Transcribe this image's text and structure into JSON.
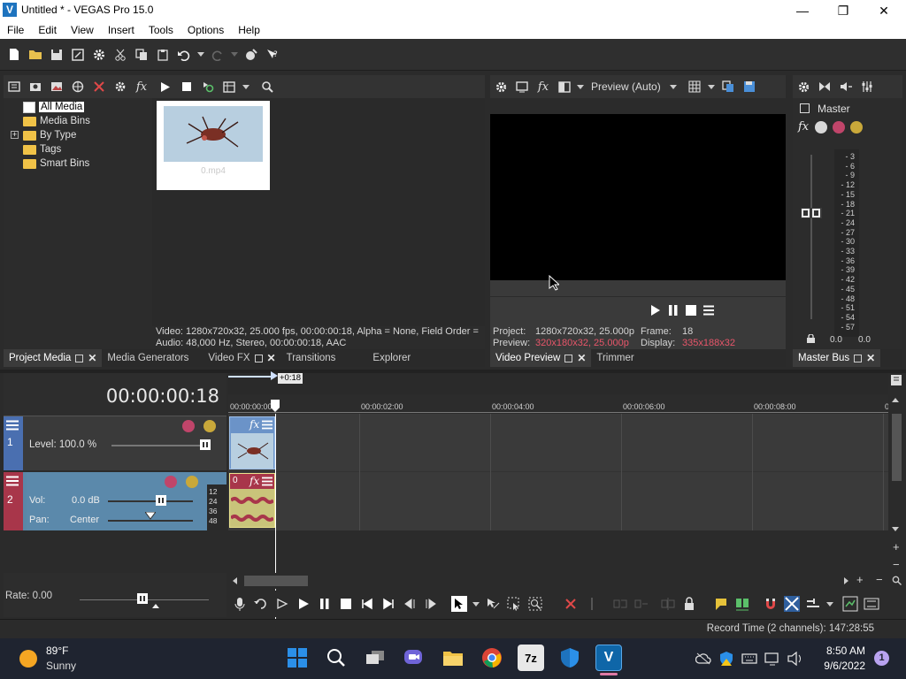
{
  "window": {
    "title": "Untitled * - VEGAS Pro 15.0",
    "logo": "V",
    "controls": {
      "minimize": "—",
      "maximize": "❐",
      "close": "✕"
    }
  },
  "menu": [
    "File",
    "Edit",
    "View",
    "Insert",
    "Tools",
    "Options",
    "Help"
  ],
  "media_panel": {
    "tree": [
      "All Media",
      "Media Bins",
      "By Type",
      "Tags",
      "Smart Bins"
    ],
    "expander": "+",
    "thumb_label": "0.mp4",
    "info_video": "Video: 1280x720x32, 25.000 fps, 00:00:00:18, Alpha = None, Field Order =",
    "info_audio": "Audio: 48,000 Hz, Stereo, 00:00:00:18, AAC",
    "tabs": [
      "Project Media",
      "Media Generators",
      "Video FX",
      "Transitions",
      "Explorer"
    ]
  },
  "preview_panel": {
    "mode_label": "Preview (Auto)",
    "project_label": "Project:",
    "project_value": "1280x720x32, 25.000p",
    "preview_label": "Preview:",
    "preview_value": "320x180x32, 25.000p",
    "frame_label": "Frame:",
    "frame_value": "18",
    "display_label": "Display:",
    "display_value": "335x188x32",
    "tabs": [
      "Video Preview",
      "Trimmer"
    ],
    "preview_value_color": "#e8566a"
  },
  "master_panel": {
    "title": "Master",
    "fx_label": "fx",
    "scale": [
      "3",
      "6",
      "9",
      "12",
      "15",
      "18",
      "21",
      "24",
      "27",
      "30",
      "33",
      "36",
      "39",
      "42",
      "45",
      "48",
      "51",
      "54",
      "57"
    ],
    "left_value": "0.0",
    "right_value": "0.0",
    "tab": "Master Bus"
  },
  "timeline": {
    "timecode": "00:00:00:18",
    "clip_duration": "+0:18",
    "ruler": [
      "00:00:00:00",
      "00:00:02:00",
      "00:00:04:00",
      "00:00:06:00",
      "00:00:08:00",
      "0"
    ],
    "video_track": {
      "number": "1",
      "level_label": "Level: 100.0 %",
      "level_percent": 100,
      "fx": "fx"
    },
    "audio_track": {
      "number": "2",
      "vol_label": "Vol:",
      "vol_value": "0.0 dB",
      "pan_label": "Pan:",
      "pan_value": "Center",
      "fx": "fx",
      "event_level": "0",
      "meter_scale": [
        "12",
        "24",
        "36",
        "48"
      ]
    },
    "rate_label": "Rate: 0.00",
    "zoom_in": "+",
    "zoom_out": "−"
  },
  "status": {
    "record_time": "Record Time (2 channels): 147:28:55"
  },
  "taskbar": {
    "weather_temp": "89°F",
    "weather_desc": "Sunny",
    "time": "8:50 AM",
    "date": "9/6/2022",
    "notifications": "1",
    "apps": [
      "start",
      "search",
      "task-view",
      "chat",
      "file-explorer",
      "chrome",
      "7zip",
      "defender",
      "vegas"
    ],
    "zip_label": "7z",
    "vegas_label": "V"
  },
  "colors": {
    "accent_video_track": "#4a6fb0",
    "accent_audio_track": "#a8364a",
    "audio_event": "#c9c47a"
  }
}
